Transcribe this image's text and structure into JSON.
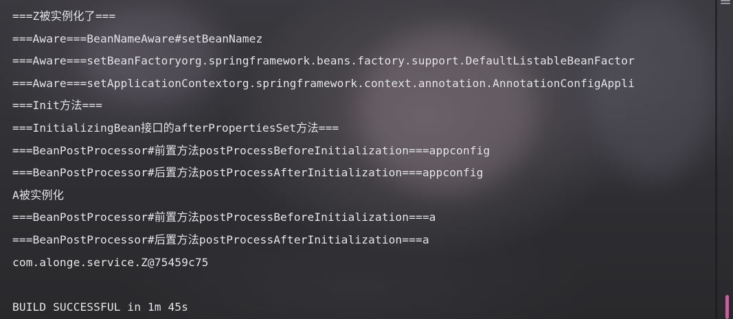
{
  "console": {
    "partial_top_line": "===Z...",
    "lines": [
      "===Z被实例化了===",
      "===Aware===BeanNameAware#setBeanNamez",
      "===Aware===setBeanFactoryorg.springframework.beans.factory.support.DefaultListableBeanFactor",
      "===Aware===setApplicationContextorg.springframework.context.annotation.AnnotationConfigAppli",
      "===Init方法===",
      "===InitializingBean接口的afterPropertiesSet方法===",
      "===BeanPostProcessor#前置方法postProcessBeforeInitialization===appconfig",
      "===BeanPostProcessor#后置方法postProcessAfterInitialization===appconfig",
      "A被实例化",
      "===BeanPostProcessor#前置方法postProcessBeforeInitialization===a",
      "===BeanPostProcessor#后置方法postProcessAfterInitialization===a",
      "com.alonge.service.Z@75459c75",
      "",
      "BUILD SUCCESSFUL in 1m 45s"
    ]
  },
  "colors": {
    "text": "#e9e9ec",
    "scroll_thumb": "#c2649b",
    "background": "#2f2f33"
  }
}
